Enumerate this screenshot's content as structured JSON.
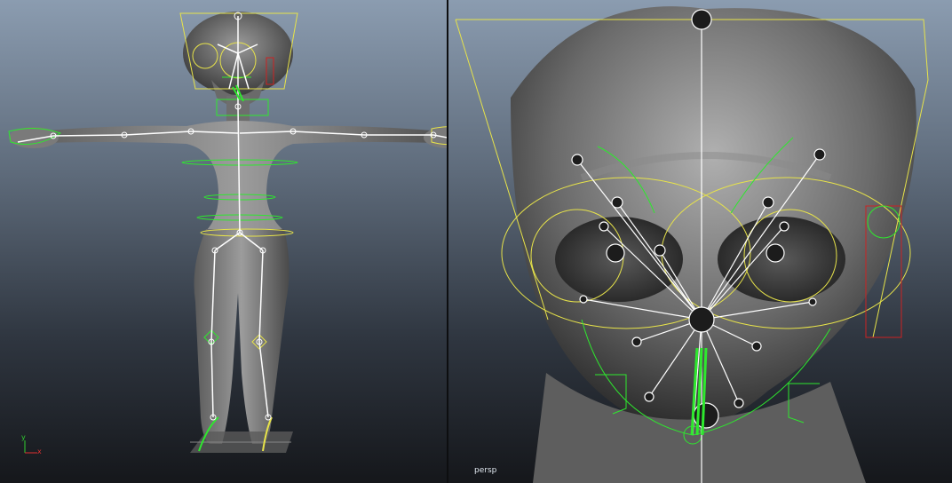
{
  "viewports": {
    "left": {
      "axes": {
        "y": "y",
        "x": "x"
      }
    },
    "right": {
      "camera": "persp"
    }
  },
  "colors": {
    "bg_top": "#8b9cb0",
    "bg_bottom": "#15171b",
    "skeleton": "#ffffff",
    "control_yellow": "#e7e34a",
    "control_green": "#2ee82e",
    "selection_red": "#cc2222",
    "axis_red": "#e03030",
    "axis_green": "#30d030"
  },
  "icons": [
    "joint-icon",
    "control-curve-icon",
    "view-axis-icon"
  ]
}
